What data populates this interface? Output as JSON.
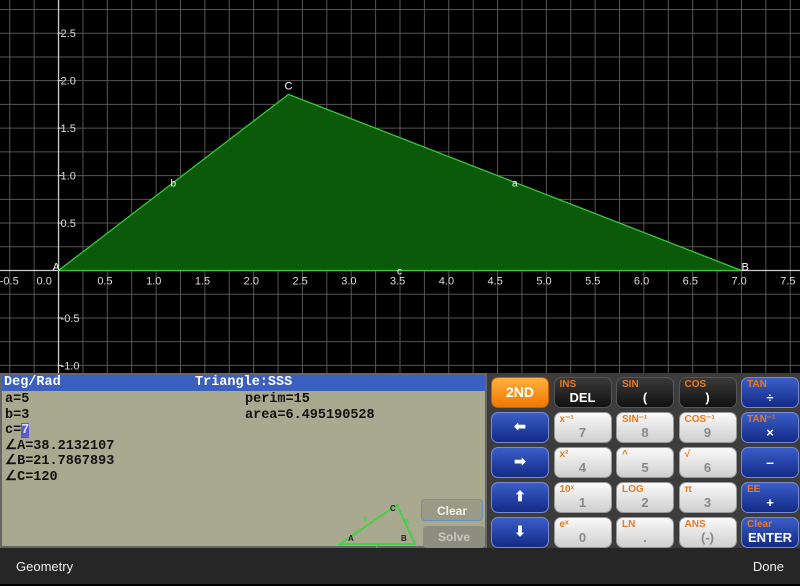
{
  "graph": {
    "x_range": [
      -0.6,
      7.6
    ],
    "y_range": [
      -1.08,
      2.85
    ],
    "grid_step": 0.25,
    "label_step": 0.5,
    "x_labels": [
      "-0.5",
      "0.0",
      "0.5",
      "1.0",
      "1.5",
      "2.0",
      "2.5",
      "3.0",
      "3.5",
      "4.0",
      "4.5",
      "5.0",
      "5.5",
      "6.0",
      "6.5",
      "7.0",
      "7.5"
    ],
    "y_labels": [
      "2.5",
      "2.0",
      "1.5",
      "1.0",
      "0.5",
      "-0.5",
      "-1.0"
    ],
    "triangle": {
      "vertices": [
        {
          "label": "A",
          "x": 0,
          "y": 0
        },
        {
          "label": "B",
          "x": 7,
          "y": 0
        },
        {
          "label": "C",
          "x": 2.357,
          "y": 1.856
        }
      ],
      "side_labels": {
        "a": "a",
        "b": "b",
        "c": "c"
      },
      "fill_color": "#0a5a0a",
      "stroke_color": "#3cc43c"
    }
  },
  "display": {
    "mode": "Deg/Rad",
    "title": "Triangle:SSS",
    "a": "a=5",
    "b": "b=3",
    "c_prefix": "c=",
    "c_value": "7",
    "angle_a": "∠A=38.2132107",
    "angle_b": "∠B=21.7867893",
    "angle_c": "∠C=120",
    "perim": "perim=15",
    "area": "area=6.495190528",
    "clear_label": "Clear",
    "solve_label": "Solve",
    "diagram_labels": {
      "A": "A",
      "B": "B",
      "C": "C",
      "a": "a",
      "b": "b",
      "c": "c"
    }
  },
  "keypad": {
    "rows": [
      [
        {
          "top": "",
          "main": "2ND",
          "style": "orange"
        },
        {
          "top": "INS",
          "main": "DEL",
          "style": "black"
        },
        {
          "top": "SIN",
          "main": "(",
          "style": "black"
        },
        {
          "top": "COS",
          "main": ")",
          "style": "black"
        },
        {
          "top": "TAN",
          "main": "÷",
          "style": "blue"
        }
      ],
      [
        {
          "top": "",
          "main": "⬅",
          "style": "blue"
        },
        {
          "top": "x⁻¹",
          "main": "7",
          "style": "white"
        },
        {
          "top": "SIN⁻¹",
          "main": "8",
          "style": "white"
        },
        {
          "top": "COS⁻¹",
          "main": "9",
          "style": "white"
        },
        {
          "top": "TAN⁻¹",
          "main": "×",
          "style": "blue"
        }
      ],
      [
        {
          "top": "",
          "main": "➡",
          "style": "blue"
        },
        {
          "top": "x²",
          "main": "4",
          "style": "white"
        },
        {
          "top": "^",
          "main": "5",
          "style": "white"
        },
        {
          "top": "√",
          "main": "6",
          "style": "white"
        },
        {
          "top": "",
          "main": "–",
          "style": "blue"
        }
      ],
      [
        {
          "top": "",
          "main": "⬆",
          "style": "blue"
        },
        {
          "top": "10ˣ",
          "main": "1",
          "style": "white"
        },
        {
          "top": "LOG",
          "main": "2",
          "style": "white"
        },
        {
          "top": "π",
          "main": "3",
          "style": "white"
        },
        {
          "top": "EE",
          "main": "+",
          "style": "blue"
        }
      ],
      [
        {
          "top": "",
          "main": "⬇",
          "style": "blue"
        },
        {
          "top": "eˣ",
          "main": "0",
          "style": "white"
        },
        {
          "top": "LN",
          "main": ".",
          "style": "white"
        },
        {
          "top": "ANS",
          "main": "(-)",
          "style": "white"
        },
        {
          "top": "Clear",
          "main": "ENTER",
          "style": "blue"
        }
      ]
    ]
  },
  "bottom_bar": {
    "left": "Geometry",
    "right": "Done"
  }
}
